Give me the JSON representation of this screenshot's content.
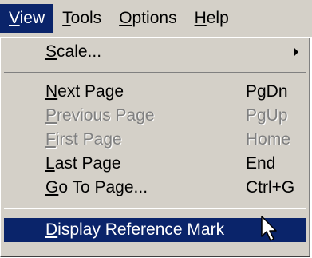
{
  "menubar": {
    "items": [
      {
        "label": "View",
        "mnemonic": "V",
        "rest": "iew",
        "active": true
      },
      {
        "label": "Tools",
        "mnemonic": "T",
        "rest": "ools"
      },
      {
        "label": "Options",
        "mnemonic": "O",
        "rest": "ptions"
      },
      {
        "label": "Help",
        "mnemonic": "H",
        "rest": "elp"
      }
    ]
  },
  "view_menu": {
    "scale": {
      "mnemonic": "S",
      "rest": "cale...",
      "label": "Scale..."
    },
    "next_page": {
      "mnemonic": "N",
      "rest": "ext Page",
      "label": "Next Page",
      "accel": "PgDn"
    },
    "previous_page": {
      "mnemonic": "P",
      "rest": "revious Page",
      "label": "Previous Page",
      "accel": "PgUp",
      "disabled": true
    },
    "first_page": {
      "mnemonic": "F",
      "rest": "irst Page",
      "label": "First Page",
      "accel": "Home",
      "disabled": true
    },
    "last_page": {
      "mnemonic": "L",
      "rest": "ast Page",
      "label": "Last Page",
      "accel": "End"
    },
    "go_to_page": {
      "mnemonic": "G",
      "rest": "o To Page...",
      "label": "Go To Page...",
      "accel": "Ctrl+G"
    },
    "display_reference_mark": {
      "mnemonic": "D",
      "rest": "isplay Reference Mark",
      "label": "Display Reference Mark",
      "highlighted": true
    }
  },
  "icons": {
    "submenu_arrow": "triangle-right-icon",
    "cursor": "mouse-pointer-icon"
  },
  "colors": {
    "menu_bg": "#d4d0c8",
    "highlight": "#0a246a",
    "disabled_text": "#808080"
  }
}
